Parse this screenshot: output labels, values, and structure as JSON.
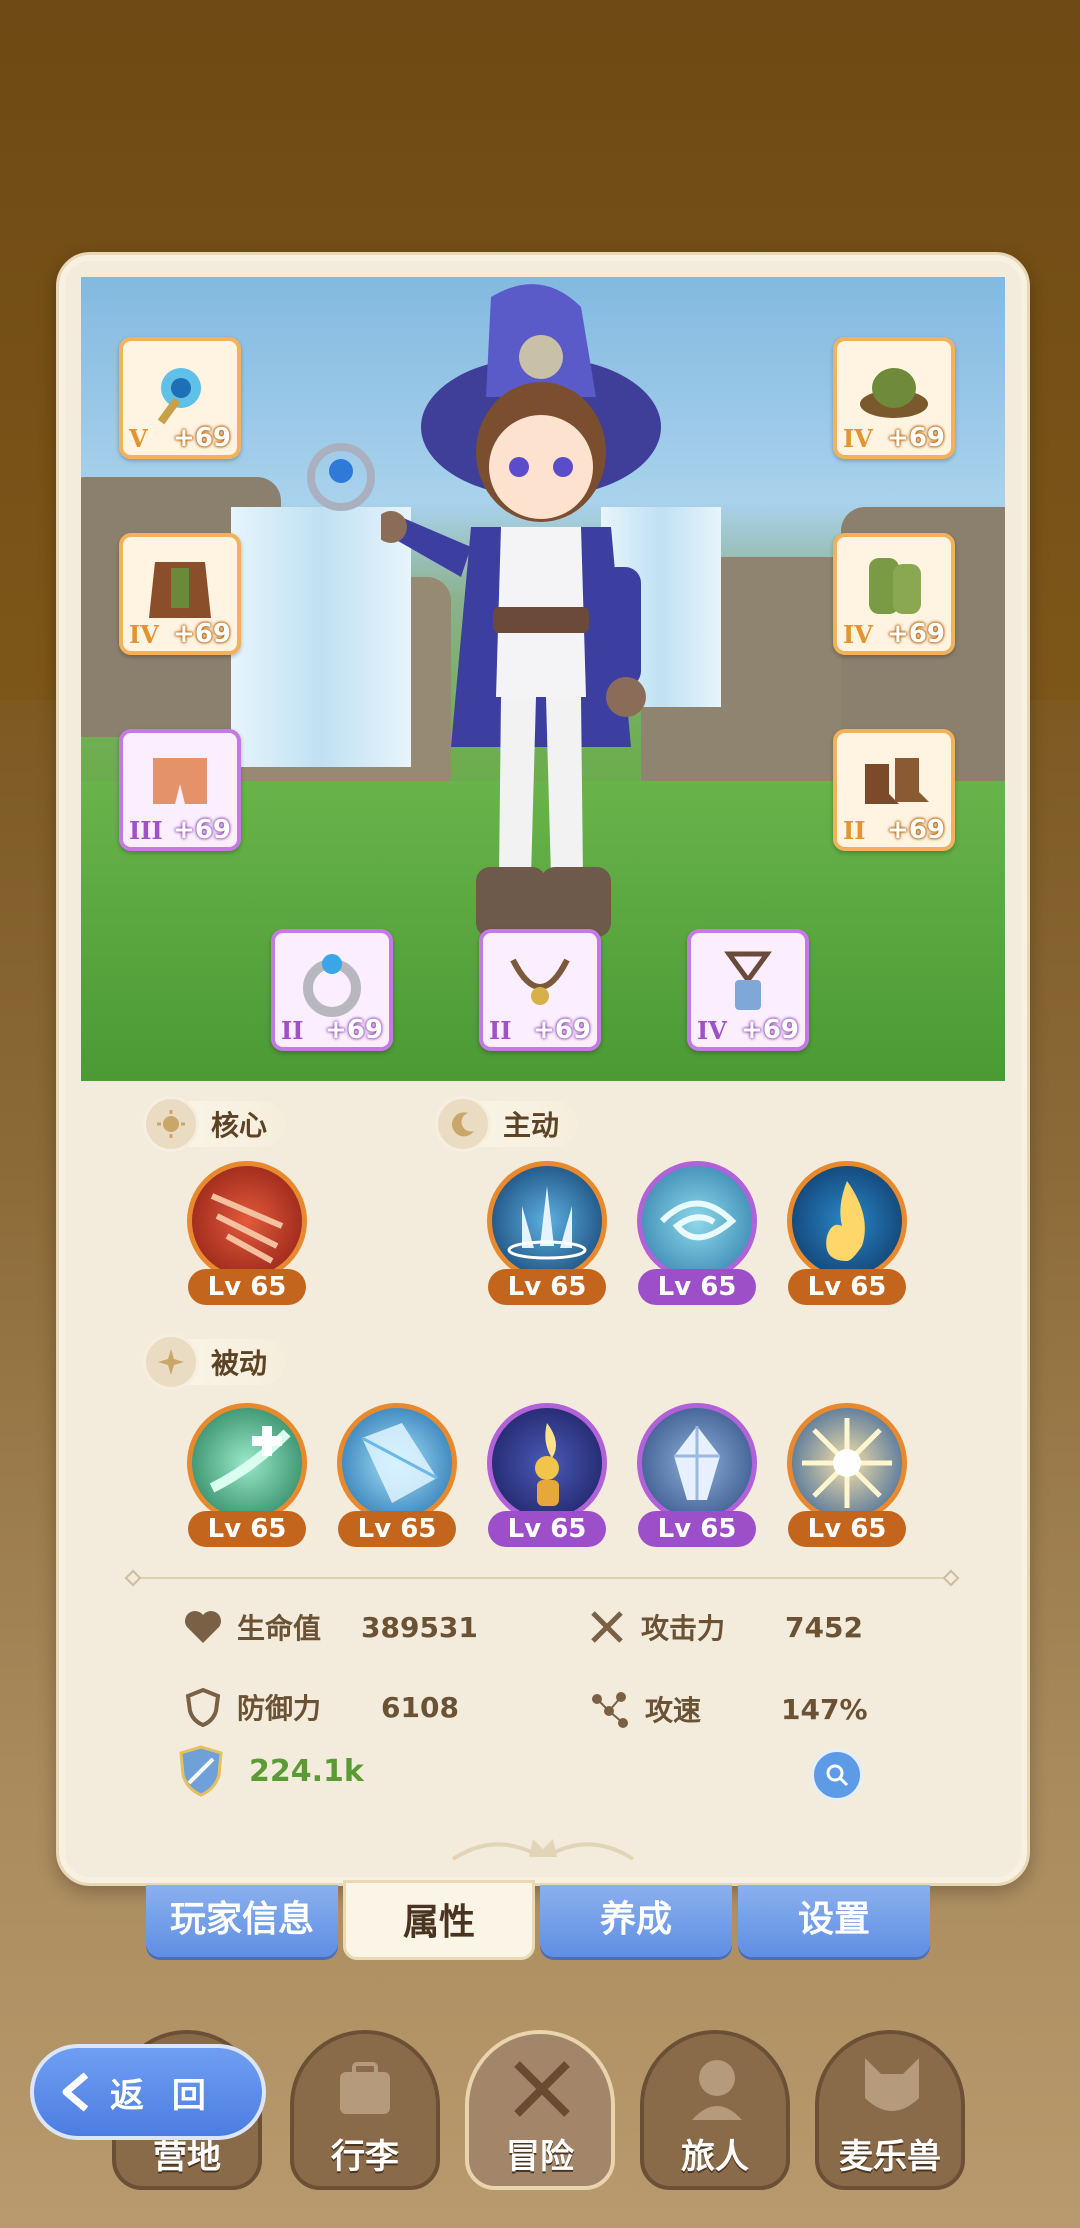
{
  "equipment": {
    "left": [
      {
        "name": "wand",
        "rarity": "V",
        "enhance": "+69",
        "tier": "orange"
      },
      {
        "name": "armor",
        "rarity": "IV",
        "enhance": "+69",
        "tier": "orange"
      },
      {
        "name": "pants",
        "rarity": "III",
        "enhance": "+69",
        "tier": "purple"
      }
    ],
    "right": [
      {
        "name": "hat",
        "rarity": "IV",
        "enhance": "+69",
        "tier": "orange"
      },
      {
        "name": "gloves",
        "rarity": "IV",
        "enhance": "+69",
        "tier": "orange"
      },
      {
        "name": "boots",
        "rarity": "II",
        "enhance": "+69",
        "tier": "orange"
      }
    ],
    "bottom": [
      {
        "name": "ring",
        "rarity": "II",
        "enhance": "+69",
        "tier": "purple"
      },
      {
        "name": "necklace",
        "rarity": "II",
        "enhance": "+69",
        "tier": "purple"
      },
      {
        "name": "amulet",
        "rarity": "IV",
        "enhance": "+69",
        "tier": "purple"
      }
    ]
  },
  "sections": {
    "core": "核心",
    "active": "主动",
    "passive": "被动"
  },
  "skills": {
    "core": [
      {
        "icon": "claw-slash-icon",
        "level": "Lv 65",
        "tier": "orange"
      }
    ],
    "active": [
      {
        "icon": "ground-spike-icon",
        "level": "Lv 65",
        "tier": "orange"
      },
      {
        "icon": "whirlwind-icon",
        "level": "Lv 65",
        "tier": "purple"
      },
      {
        "icon": "flame-icon",
        "level": "Lv 65",
        "tier": "orange"
      }
    ],
    "passive": [
      {
        "icon": "heal-plus-icon",
        "level": "Lv 65",
        "tier": "orange"
      },
      {
        "icon": "ice-shard-icon",
        "level": "Lv 65",
        "tier": "orange"
      },
      {
        "icon": "lightbulb-hand-icon",
        "level": "Lv 65",
        "tier": "purple"
      },
      {
        "icon": "crystal-icon",
        "level": "Lv 65",
        "tier": "purple"
      },
      {
        "icon": "burst-icon",
        "level": "Lv 65",
        "tier": "orange"
      }
    ]
  },
  "stats": {
    "hp": {
      "label": "生命值",
      "value": "389531"
    },
    "attack": {
      "label": "攻击力",
      "value": "7452"
    },
    "defense": {
      "label": "防御力",
      "value": "6108"
    },
    "speed": {
      "label": "攻速",
      "value": "147%"
    },
    "power": "224.1k"
  },
  "tabs": [
    "玩家信息",
    "属性",
    "养成",
    "设置"
  ],
  "active_tab": "属性",
  "nav": [
    "营地",
    "行李",
    "冒险",
    "旅人",
    "麦乐兽"
  ],
  "back": "返 回",
  "colors": {
    "orange": "#e8892e",
    "purple": "#b162d8",
    "power_green": "#5b9b33",
    "tab_blue": "#5f8ee3"
  }
}
